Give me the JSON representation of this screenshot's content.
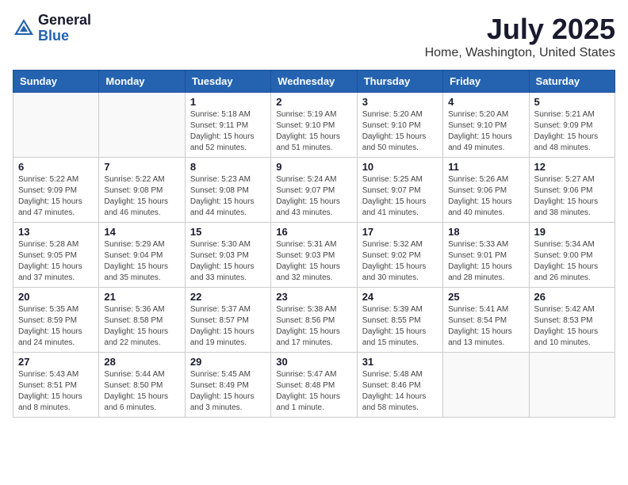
{
  "logo": {
    "general": "General",
    "blue": "Blue"
  },
  "header": {
    "month": "July 2025",
    "location": "Home, Washington, United States"
  },
  "weekdays": [
    "Sunday",
    "Monday",
    "Tuesday",
    "Wednesday",
    "Thursday",
    "Friday",
    "Saturday"
  ],
  "weeks": [
    [
      {
        "day": "",
        "sunrise": "",
        "sunset": "",
        "daylight": ""
      },
      {
        "day": "",
        "sunrise": "",
        "sunset": "",
        "daylight": ""
      },
      {
        "day": "1",
        "sunrise": "Sunrise: 5:18 AM",
        "sunset": "Sunset: 9:11 PM",
        "daylight": "Daylight: 15 hours and 52 minutes."
      },
      {
        "day": "2",
        "sunrise": "Sunrise: 5:19 AM",
        "sunset": "Sunset: 9:10 PM",
        "daylight": "Daylight: 15 hours and 51 minutes."
      },
      {
        "day": "3",
        "sunrise": "Sunrise: 5:20 AM",
        "sunset": "Sunset: 9:10 PM",
        "daylight": "Daylight: 15 hours and 50 minutes."
      },
      {
        "day": "4",
        "sunrise": "Sunrise: 5:20 AM",
        "sunset": "Sunset: 9:10 PM",
        "daylight": "Daylight: 15 hours and 49 minutes."
      },
      {
        "day": "5",
        "sunrise": "Sunrise: 5:21 AM",
        "sunset": "Sunset: 9:09 PM",
        "daylight": "Daylight: 15 hours and 48 minutes."
      }
    ],
    [
      {
        "day": "6",
        "sunrise": "Sunrise: 5:22 AM",
        "sunset": "Sunset: 9:09 PM",
        "daylight": "Daylight: 15 hours and 47 minutes."
      },
      {
        "day": "7",
        "sunrise": "Sunrise: 5:22 AM",
        "sunset": "Sunset: 9:08 PM",
        "daylight": "Daylight: 15 hours and 46 minutes."
      },
      {
        "day": "8",
        "sunrise": "Sunrise: 5:23 AM",
        "sunset": "Sunset: 9:08 PM",
        "daylight": "Daylight: 15 hours and 44 minutes."
      },
      {
        "day": "9",
        "sunrise": "Sunrise: 5:24 AM",
        "sunset": "Sunset: 9:07 PM",
        "daylight": "Daylight: 15 hours and 43 minutes."
      },
      {
        "day": "10",
        "sunrise": "Sunrise: 5:25 AM",
        "sunset": "Sunset: 9:07 PM",
        "daylight": "Daylight: 15 hours and 41 minutes."
      },
      {
        "day": "11",
        "sunrise": "Sunrise: 5:26 AM",
        "sunset": "Sunset: 9:06 PM",
        "daylight": "Daylight: 15 hours and 40 minutes."
      },
      {
        "day": "12",
        "sunrise": "Sunrise: 5:27 AM",
        "sunset": "Sunset: 9:06 PM",
        "daylight": "Daylight: 15 hours and 38 minutes."
      }
    ],
    [
      {
        "day": "13",
        "sunrise": "Sunrise: 5:28 AM",
        "sunset": "Sunset: 9:05 PM",
        "daylight": "Daylight: 15 hours and 37 minutes."
      },
      {
        "day": "14",
        "sunrise": "Sunrise: 5:29 AM",
        "sunset": "Sunset: 9:04 PM",
        "daylight": "Daylight: 15 hours and 35 minutes."
      },
      {
        "day": "15",
        "sunrise": "Sunrise: 5:30 AM",
        "sunset": "Sunset: 9:03 PM",
        "daylight": "Daylight: 15 hours and 33 minutes."
      },
      {
        "day": "16",
        "sunrise": "Sunrise: 5:31 AM",
        "sunset": "Sunset: 9:03 PM",
        "daylight": "Daylight: 15 hours and 32 minutes."
      },
      {
        "day": "17",
        "sunrise": "Sunrise: 5:32 AM",
        "sunset": "Sunset: 9:02 PM",
        "daylight": "Daylight: 15 hours and 30 minutes."
      },
      {
        "day": "18",
        "sunrise": "Sunrise: 5:33 AM",
        "sunset": "Sunset: 9:01 PM",
        "daylight": "Daylight: 15 hours and 28 minutes."
      },
      {
        "day": "19",
        "sunrise": "Sunrise: 5:34 AM",
        "sunset": "Sunset: 9:00 PM",
        "daylight": "Daylight: 15 hours and 26 minutes."
      }
    ],
    [
      {
        "day": "20",
        "sunrise": "Sunrise: 5:35 AM",
        "sunset": "Sunset: 8:59 PM",
        "daylight": "Daylight: 15 hours and 24 minutes."
      },
      {
        "day": "21",
        "sunrise": "Sunrise: 5:36 AM",
        "sunset": "Sunset: 8:58 PM",
        "daylight": "Daylight: 15 hours and 22 minutes."
      },
      {
        "day": "22",
        "sunrise": "Sunrise: 5:37 AM",
        "sunset": "Sunset: 8:57 PM",
        "daylight": "Daylight: 15 hours and 19 minutes."
      },
      {
        "day": "23",
        "sunrise": "Sunrise: 5:38 AM",
        "sunset": "Sunset: 8:56 PM",
        "daylight": "Daylight: 15 hours and 17 minutes."
      },
      {
        "day": "24",
        "sunrise": "Sunrise: 5:39 AM",
        "sunset": "Sunset: 8:55 PM",
        "daylight": "Daylight: 15 hours and 15 minutes."
      },
      {
        "day": "25",
        "sunrise": "Sunrise: 5:41 AM",
        "sunset": "Sunset: 8:54 PM",
        "daylight": "Daylight: 15 hours and 13 minutes."
      },
      {
        "day": "26",
        "sunrise": "Sunrise: 5:42 AM",
        "sunset": "Sunset: 8:53 PM",
        "daylight": "Daylight: 15 hours and 10 minutes."
      }
    ],
    [
      {
        "day": "27",
        "sunrise": "Sunrise: 5:43 AM",
        "sunset": "Sunset: 8:51 PM",
        "daylight": "Daylight: 15 hours and 8 minutes."
      },
      {
        "day": "28",
        "sunrise": "Sunrise: 5:44 AM",
        "sunset": "Sunset: 8:50 PM",
        "daylight": "Daylight: 15 hours and 6 minutes."
      },
      {
        "day": "29",
        "sunrise": "Sunrise: 5:45 AM",
        "sunset": "Sunset: 8:49 PM",
        "daylight": "Daylight: 15 hours and 3 minutes."
      },
      {
        "day": "30",
        "sunrise": "Sunrise: 5:47 AM",
        "sunset": "Sunset: 8:48 PM",
        "daylight": "Daylight: 15 hours and 1 minute."
      },
      {
        "day": "31",
        "sunrise": "Sunrise: 5:48 AM",
        "sunset": "Sunset: 8:46 PM",
        "daylight": "Daylight: 14 hours and 58 minutes."
      },
      {
        "day": "",
        "sunrise": "",
        "sunset": "",
        "daylight": ""
      },
      {
        "day": "",
        "sunrise": "",
        "sunset": "",
        "daylight": ""
      }
    ]
  ]
}
